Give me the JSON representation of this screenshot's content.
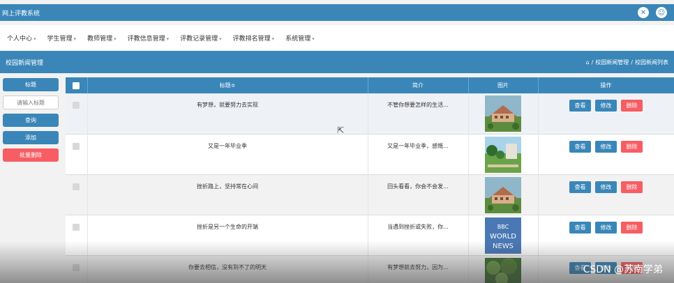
{
  "topbar": {
    "app_title": "网上评教系统",
    "icons": [
      "fullscreen-icon",
      "user-icon"
    ]
  },
  "nav": [
    {
      "label": "个人中心"
    },
    {
      "label": "学生管理"
    },
    {
      "label": "教师管理"
    },
    {
      "label": "评教信息管理"
    },
    {
      "label": "评教记录管理"
    },
    {
      "label": "评教排名管理"
    },
    {
      "label": "系统管理"
    }
  ],
  "page": {
    "title": "校园新闻管理",
    "breadcrumb": [
      "校园新闻管理",
      "校园新闻列表"
    ],
    "breadcrumb_sep": "/"
  },
  "filter": {
    "label": "标题",
    "placeholder": "请输入标题",
    "search": "查询",
    "add": "添加",
    "batch_delete": "批量删除"
  },
  "table": {
    "headers": [
      "标题≑",
      "简介",
      "图片",
      "操作"
    ],
    "actions": {
      "view": "查看",
      "edit": "修改",
      "delete": "删除"
    },
    "rows": [
      {
        "title": "有梦想，就要努力去实现",
        "intro": "不管你想要怎样的生活...",
        "image": "campus"
      },
      {
        "title": "又是一年毕业季",
        "intro": "又是一年毕业季，感慨...",
        "image": "garden"
      },
      {
        "title": "挫折路上，坚持常在心间",
        "intro": "回头看看，你会不会发...",
        "image": "campus"
      },
      {
        "title": "挫折是另一个生命的开端",
        "intro": "当遇到挫折或失败，你...",
        "image": "bbc"
      },
      {
        "title": "你要去相信，没有到不了的明天",
        "intro": "有梦想就去努力，因为...",
        "image": "trees"
      }
    ]
  },
  "bbc": {
    "line1": "BBC",
    "line2": "WORLD",
    "line3": "NEWS"
  },
  "watermark": "CSDN @苏南学弟",
  "colors": {
    "primary": "#3a86b8",
    "danger": "#f75d62"
  }
}
